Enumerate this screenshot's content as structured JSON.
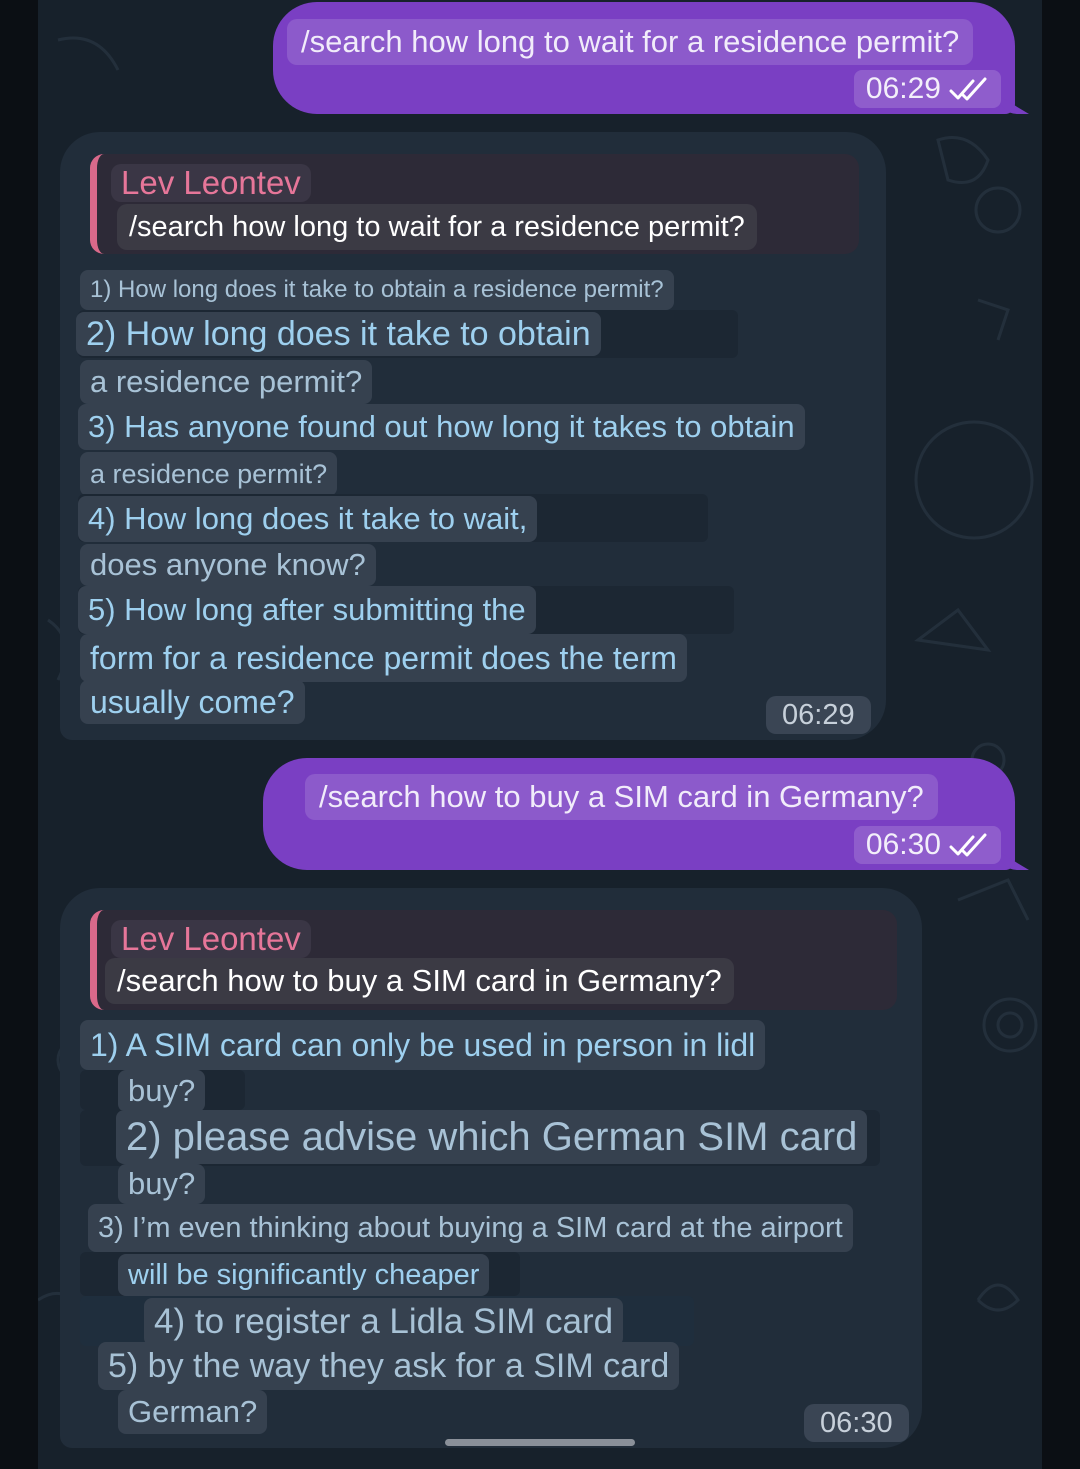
{
  "messages": [
    {
      "type": "outgoing",
      "text": "/search how long to wait for a residence permit?",
      "time": "06:29"
    },
    {
      "type": "incoming",
      "quote_author": "Lev Leontev",
      "quote_text": "/search how long to wait for a residence permit?",
      "lines": [
        "1) How long does it take to obtain a residence permit?",
        "2) How long does it take to obtain",
        "a residence permit?",
        "3) Has anyone found out how long it takes to obtain",
        "a residence permit?",
        "4) How long does it take to wait,",
        "does anyone know?",
        "5) How long after submitting the",
        "form for a residence permit does the term",
        "usually come?"
      ],
      "time": "06:29"
    },
    {
      "type": "outgoing",
      "text": "/search how to buy a SIM card in Germany?",
      "time": "06:30"
    },
    {
      "type": "incoming",
      "quote_author": "Lev Leontev",
      "quote_text": "/search how to buy a SIM card in Germany?",
      "lines": [
        "1) A SIM card can only be used in person in lidl",
        "buy?",
        "2) please advise which German SIM card",
        "buy?",
        "3) I’m even thinking about buying a SIM card at the airport",
        "will be significantly cheaper",
        "4) to register a Lidla SIM card",
        "5) by the way they ask for a SIM card",
        "German?"
      ],
      "time": "06:30"
    }
  ],
  "status": {
    "read_icon": "double-check-icon"
  },
  "colors": {
    "outgoing_bubble": "#7a3fc3",
    "incoming_bubble": "#212d3a",
    "chat_background": "#17212b",
    "quote_accent": "#d9698a",
    "link_text": "#9ed0ef"
  }
}
